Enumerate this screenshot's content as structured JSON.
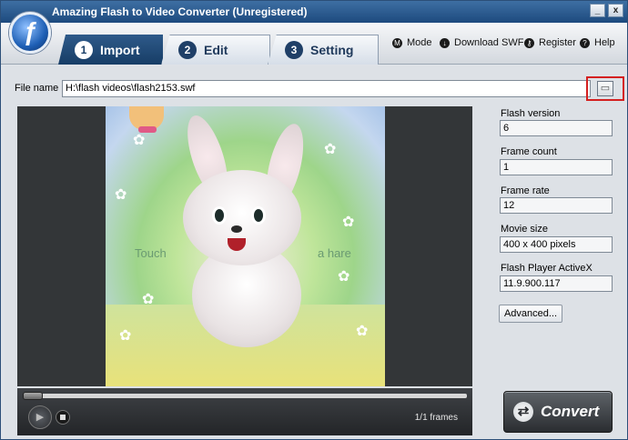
{
  "window": {
    "title": "Amazing Flash to Video Converter (Unregistered)",
    "controls": [
      "_",
      "x"
    ]
  },
  "tabs": [
    {
      "num": "1",
      "label": "Import",
      "active": true
    },
    {
      "num": "2",
      "label": "Edit",
      "active": false
    },
    {
      "num": "3",
      "label": "Setting",
      "active": false
    }
  ],
  "menu": [
    {
      "label": "Mode",
      "icon": "mode-icon",
      "glyph": "M"
    },
    {
      "label": "Download SWF",
      "icon": "download-icon",
      "glyph": "↓"
    },
    {
      "label": "Register",
      "icon": "key-icon",
      "glyph": "⚷"
    },
    {
      "label": "Help",
      "icon": "help-icon",
      "glyph": "?"
    }
  ],
  "file": {
    "label": "File name",
    "value": "H:\\flash videos\\flash2153.swf"
  },
  "preview": {
    "text_left": "Touch",
    "text_right": "a hare",
    "frames": "1/1 frames"
  },
  "info": {
    "flash_version_label": "Flash version",
    "flash_version": "6",
    "frame_count_label": "Frame count",
    "frame_count": "1",
    "frame_rate_label": "Frame rate",
    "frame_rate": "12",
    "movie_size_label": "Movie size",
    "movie_size": "400 x 400 pixels",
    "player_label": "Flash Player ActiveX",
    "player_version": "11.9.900.117",
    "advanced_label": "Advanced..."
  },
  "convert": {
    "label": "Convert"
  },
  "colors": {
    "accent": "#1f3f67",
    "highlight_border": "#d42020"
  }
}
